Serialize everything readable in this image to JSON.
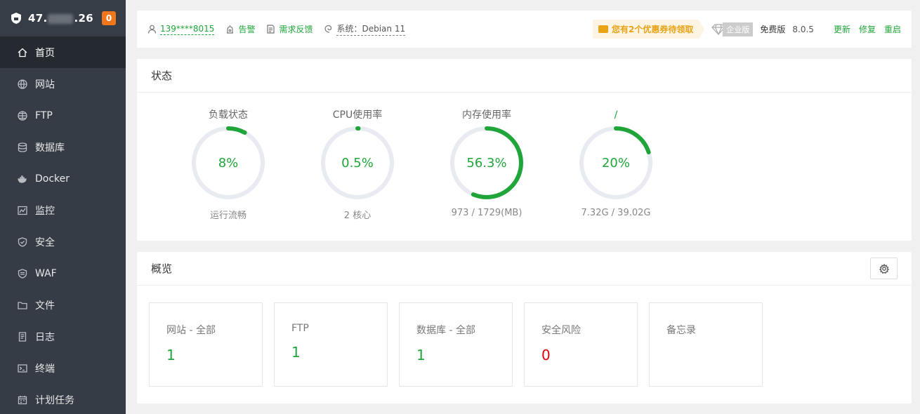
{
  "sidebar": {
    "ip_prefix": "47.",
    "ip_suffix": ".26",
    "badge": "0",
    "items": [
      {
        "label": "首页",
        "icon": "home-icon",
        "active": true
      },
      {
        "label": "网站",
        "icon": "globe-icon"
      },
      {
        "label": "FTP",
        "icon": "ftp-icon"
      },
      {
        "label": "数据库",
        "icon": "database-icon"
      },
      {
        "label": "Docker",
        "icon": "docker-icon"
      },
      {
        "label": "监控",
        "icon": "monitor-icon"
      },
      {
        "label": "安全",
        "icon": "shield-icon"
      },
      {
        "label": "WAF",
        "icon": "waf-icon"
      },
      {
        "label": "文件",
        "icon": "folder-icon"
      },
      {
        "label": "日志",
        "icon": "log-icon"
      },
      {
        "label": "终端",
        "icon": "terminal-icon"
      },
      {
        "label": "计划任务",
        "icon": "calendar-icon"
      }
    ]
  },
  "topbar": {
    "user": "139****8015",
    "alarm": "告警",
    "feedback": "需求反馈",
    "system": "系统：Debian 11",
    "coupon": "您有2个优惠券待领取",
    "enterprise_tag": "企业版",
    "edition": "免费版",
    "version": "8.0.5",
    "update": "更新",
    "repair": "修复",
    "restart": "重启"
  },
  "status": {
    "title": "状态",
    "gauges": [
      {
        "title": "负载状态",
        "value": "8%",
        "percent": 8,
        "sub": "运行流畅"
      },
      {
        "title": "CPU使用率",
        "value": "0.5%",
        "percent": 0.5,
        "sub": "2 核心"
      },
      {
        "title": "内存使用率",
        "value": "56.3%",
        "percent": 56.3,
        "sub": "973 / 1729(MB)"
      },
      {
        "title": "/",
        "value": "20%",
        "percent": 20,
        "sub": "7.32G / 39.02G"
      }
    ]
  },
  "overview": {
    "title": "概览",
    "cards": [
      {
        "label": "网站 - 全部",
        "value": "1"
      },
      {
        "label": "FTP",
        "value": "1"
      },
      {
        "label": "数据库 - 全部",
        "value": "1"
      },
      {
        "label": "安全风险",
        "value": "0"
      },
      {
        "label": "备忘录",
        "value": ""
      }
    ]
  },
  "colors": {
    "accent": "#20a53a",
    "danger": "#d9000d",
    "sidebar": "#353c45",
    "track": "#e8ebf2"
  }
}
